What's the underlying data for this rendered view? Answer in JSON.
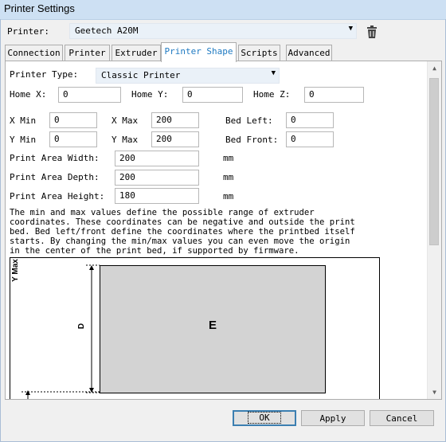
{
  "window": {
    "title": "Printer Settings"
  },
  "printer": {
    "label": "Printer:",
    "selected": "Geetech A20M"
  },
  "tabs": [
    {
      "label": "Connection"
    },
    {
      "label": "Printer"
    },
    {
      "label": "Extruder"
    },
    {
      "label": "Printer Shape",
      "active": true
    },
    {
      "label": "Scripts"
    },
    {
      "label": "Advanced"
    }
  ],
  "shape": {
    "printer_type_label": "Printer Type:",
    "printer_type_value": "Classic Printer",
    "home_x_label": "Home X:",
    "home_x": "0",
    "home_y_label": "Home Y:",
    "home_y": "0",
    "home_z_label": "Home Z:",
    "home_z": "0",
    "x_min_label": "X Min",
    "x_min": "0",
    "x_max_label": "X Max",
    "x_max": "200",
    "bed_left_label": "Bed Left:",
    "bed_left": "0",
    "y_min_label": "Y Min",
    "y_min": "0",
    "y_max_label": "Y Max",
    "y_max": "200",
    "bed_front_label": "Bed Front:",
    "bed_front": "0",
    "width_label": "Print Area Width:",
    "width": "200",
    "width_unit": "mm",
    "depth_label": "Print Area Depth:",
    "depth": "200",
    "depth_unit": "mm",
    "height_label": "Print Area Height:",
    "height": "180",
    "height_unit": "mm",
    "description": "The min and max values define the possible range of extruder coordinates. These coordinates can be negative and outside the print bed. Bed left/front define the coordinates where the printbed itself starts. By changing the min/max values you can even move the origin in the center of the print bed, if supported by firmware.",
    "diagram": {
      "y_axis_label": "Y Max",
      "depth_marker": "D",
      "bed_label": "E"
    }
  },
  "buttons": {
    "ok": "OK",
    "apply": "Apply",
    "cancel": "Cancel"
  },
  "colors": {
    "active_tab": "#1f7ac2",
    "title_bar": "#cde0f3",
    "bed_fill": "#d3d3d3"
  }
}
